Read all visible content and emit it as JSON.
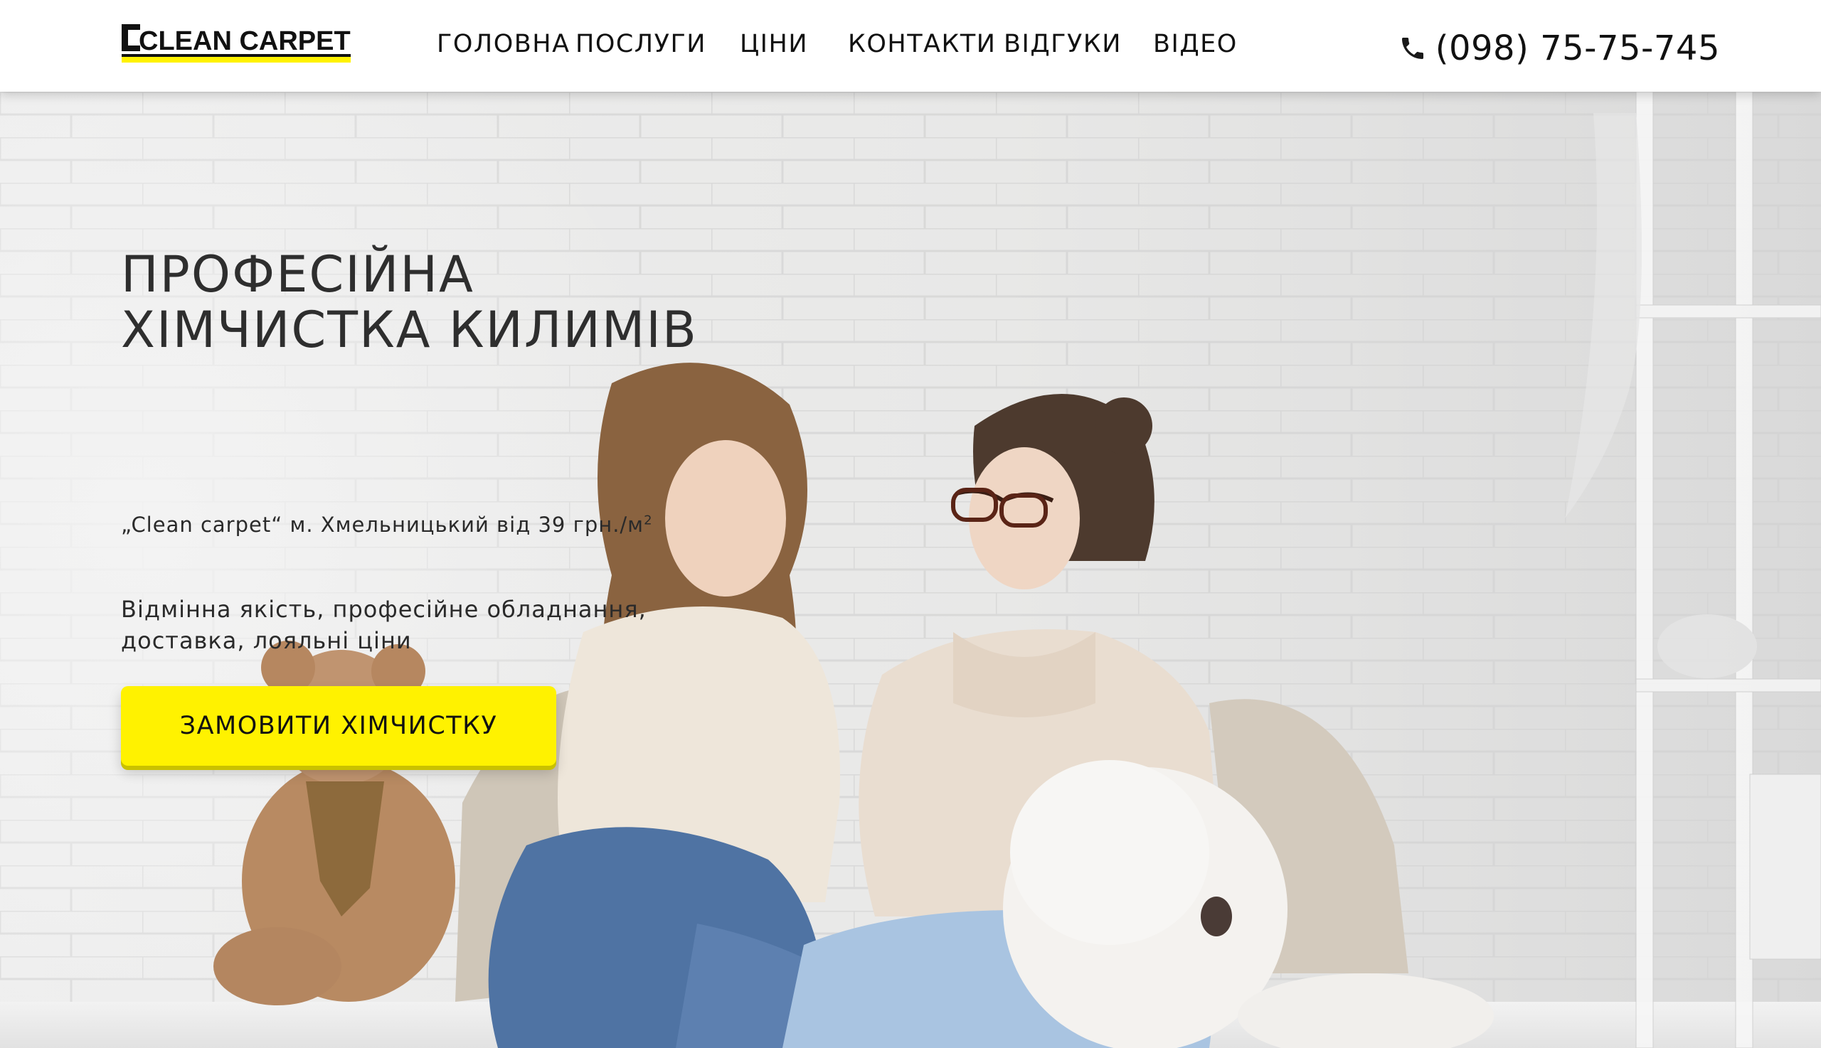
{
  "header": {
    "logo_text": "CLEAN CARPET",
    "nav": [
      {
        "label": "ГОЛОВНА"
      },
      {
        "label": "ПОСЛУГИ"
      },
      {
        "label": "ЦІНИ"
      },
      {
        "label": "КОНТАКТИ"
      },
      {
        "label": "ВІДГУКИ"
      },
      {
        "label": "ВІДЕО"
      }
    ],
    "phone_icon": "phone-icon",
    "phone": "(098) 75-75-745"
  },
  "hero": {
    "title_line1": "ПРОФЕСІЙНА",
    "title_line2": "ХІМЧИСТКА КИЛИМІВ",
    "subtitle": "„Clean carpet“ м. Хмельницький від 39 грн./м",
    "subtitle_sup": "2",
    "desc_line1": "Відмінна якість, професійне обладнання,",
    "desc_line2": "доставка, лояльні ціни",
    "cta_label": "ЗАМОВИТИ ХІМЧИСТКУ"
  },
  "colors": {
    "accent": "#fff200",
    "text": "#111111",
    "background_wall": "#ebebea"
  }
}
